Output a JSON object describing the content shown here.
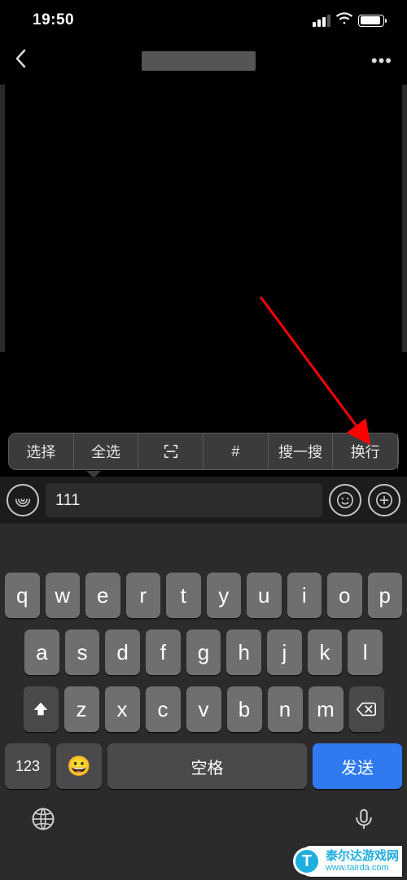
{
  "status": {
    "time": "19:50"
  },
  "nav": {
    "back": "‹",
    "more": "•••"
  },
  "text_menu": {
    "select": "选择",
    "select_all": "全选",
    "hash": "#",
    "search": "搜一搜",
    "newline": "换行"
  },
  "input": {
    "value": "111"
  },
  "keyboard": {
    "row1": [
      "q",
      "w",
      "e",
      "r",
      "t",
      "y",
      "u",
      "i",
      "o",
      "p"
    ],
    "row2": [
      "a",
      "s",
      "d",
      "f",
      "g",
      "h",
      "j",
      "k",
      "l"
    ],
    "row3": [
      "z",
      "x",
      "c",
      "v",
      "b",
      "n",
      "m"
    ],
    "k123": "123",
    "space": "空格",
    "send": "发送"
  },
  "watermark": {
    "title": "泰尔达游戏网",
    "url": "www.tairda.com"
  },
  "annotation": {
    "arrow_target": "text-menu-newline"
  }
}
